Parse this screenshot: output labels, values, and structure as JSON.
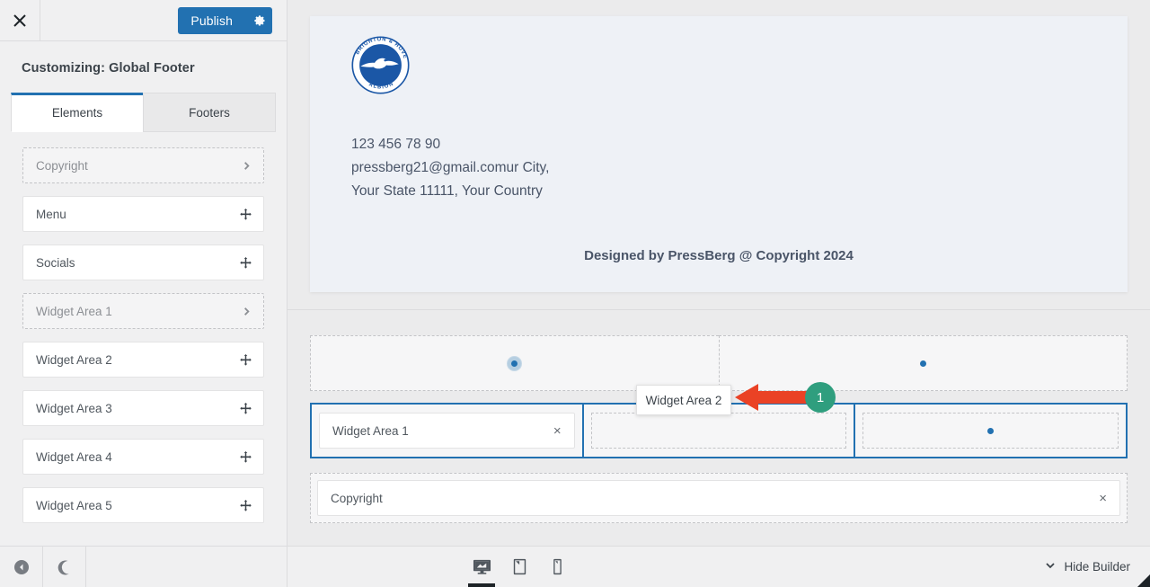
{
  "customizer": {
    "close_icon": "close-icon",
    "publish_label": "Publish",
    "gear_icon": "gear-icon",
    "title": "Customizing: Global Footer",
    "tabs": [
      {
        "label": "Elements",
        "active": true
      },
      {
        "label": "Footers",
        "active": false
      }
    ],
    "elements": [
      {
        "label": "Copyright",
        "state": "placed",
        "icon": "chevron-right-icon"
      },
      {
        "label": "Menu",
        "state": "available",
        "icon": "drag-handle-icon"
      },
      {
        "label": "Socials",
        "state": "available",
        "icon": "drag-handle-icon"
      },
      {
        "label": "Widget Area 1",
        "state": "placed",
        "icon": "chevron-right-icon"
      },
      {
        "label": "Widget Area 2",
        "state": "available",
        "icon": "drag-handle-icon"
      },
      {
        "label": "Widget Area 3",
        "state": "available",
        "icon": "drag-handle-icon"
      },
      {
        "label": "Widget Area 4",
        "state": "available",
        "icon": "drag-handle-icon"
      },
      {
        "label": "Widget Area 5",
        "state": "available",
        "icon": "drag-handle-icon"
      }
    ],
    "footer_buttons": [
      {
        "icon": "back-arrow-icon"
      },
      {
        "icon": "dark-mode-icon"
      }
    ]
  },
  "preview": {
    "logo_alt": "Brighton & Hove Albion crest",
    "logo_text_top": "BRIGHTON & HOVE",
    "logo_text_bottom": "ALBION",
    "contact_lines": [
      "123 456 78 90",
      "pressberg21@gmail.comur City,",
      "Your State 11111, Your Country"
    ],
    "copyright_text": "Designed by PressBerg @ Copyright 2024"
  },
  "builder": {
    "row1": [
      {
        "dot": true,
        "hover": true
      },
      {
        "dot": true,
        "hover": false
      }
    ],
    "row2": [
      {
        "type": "item",
        "label": "Widget Area 1",
        "remove_label": "×"
      },
      {
        "type": "empty",
        "label": ""
      },
      {
        "type": "empty",
        "label": "",
        "dot": true
      }
    ],
    "row3": {
      "type": "item",
      "label": "Copyright",
      "remove_label": "×"
    },
    "drag_ghost_label": "Widget Area 2",
    "annotation": {
      "badge": "1",
      "arrow": "left-arrow-icon"
    }
  },
  "bottombar": {
    "devices": [
      {
        "icon": "desktop-icon",
        "active": true
      },
      {
        "icon": "tablet-icon",
        "active": false
      },
      {
        "icon": "mobile-icon",
        "active": false
      }
    ],
    "hide_builder_label": "Hide Builder",
    "hide_builder_icon": "chevron-down-icon"
  },
  "colors": {
    "accent": "#2271b1",
    "annotation_arrow": "#ea4225",
    "annotation_badge": "#2f9e7e",
    "logo_blue": "#1b57a6",
    "panel_bg": "#f0f0f1",
    "preview_bg": "#eef1f6"
  }
}
